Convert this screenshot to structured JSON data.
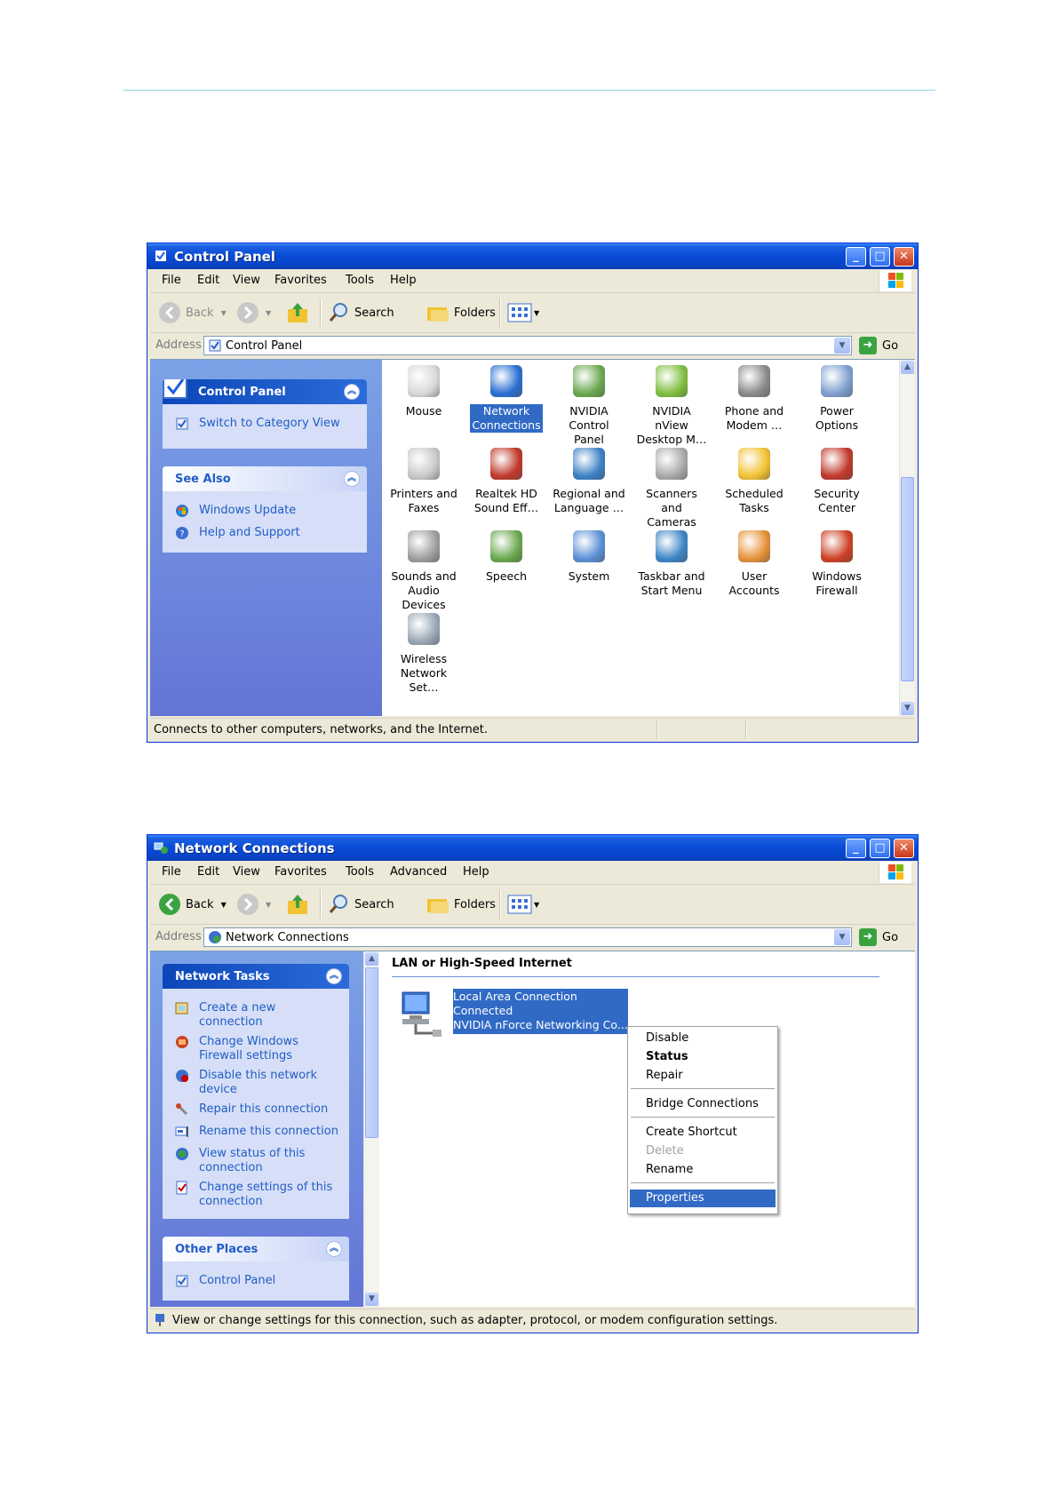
{
  "window1": {
    "title": "Control Panel",
    "menu": [
      "File",
      "Edit",
      "View",
      "Favorites",
      "Tools",
      "Help"
    ],
    "toolbar": {
      "back": "Back",
      "search": "Search",
      "folders": "Folders"
    },
    "address": {
      "label": "Address",
      "value": "Control Panel",
      "go": "Go"
    },
    "taskpane": {
      "control_panel": {
        "title": "Control Panel",
        "link": "Switch to Category View"
      },
      "see_also": {
        "title": "See Also",
        "links": [
          "Windows Update",
          "Help and Support"
        ]
      }
    },
    "items": [
      {
        "l1": "Mouse",
        "l2": "",
        "color": "#d8d8d8"
      },
      {
        "l1": "Network",
        "l2": "Connections",
        "color": "#2a6fd0"
      },
      {
        "l1": "NVIDIA",
        "l2": "Control Panel",
        "color": "#6aa84f"
      },
      {
        "l1": "NVIDIA nView",
        "l2": "Desktop M…",
        "color": "#7fbf3f"
      },
      {
        "l1": "Phone and",
        "l2": "Modem …",
        "color": "#8a8a8a"
      },
      {
        "l1": "Power Options",
        "l2": "",
        "color": "#7f9fcf"
      },
      {
        "l1": "Printers and",
        "l2": "Faxes",
        "color": "#c9c9c9"
      },
      {
        "l1": "Realtek HD",
        "l2": "Sound Eff…",
        "color": "#c0392b"
      },
      {
        "l1": "Regional and",
        "l2": "Language …",
        "color": "#3b82c4"
      },
      {
        "l1": "Scanners and",
        "l2": "Cameras",
        "color": "#a9a9a9"
      },
      {
        "l1": "Scheduled",
        "l2": "Tasks",
        "color": "#f1c232"
      },
      {
        "l1": "Security",
        "l2": "Center",
        "color": "#c0392b"
      },
      {
        "l1": "Sounds and",
        "l2": "Audio Devices",
        "color": "#9e9e9e"
      },
      {
        "l1": "Speech",
        "l2": "",
        "color": "#6aa84f"
      },
      {
        "l1": "System",
        "l2": "",
        "color": "#5b8fd6"
      },
      {
        "l1": "Taskbar and",
        "l2": "Start Menu",
        "color": "#3d85c6"
      },
      {
        "l1": "User Accounts",
        "l2": "",
        "color": "#e69138"
      },
      {
        "l1": "Windows",
        "l2": "Firewall",
        "color": "#cc4125"
      },
      {
        "l1": "Wireless",
        "l2": "Network Set…",
        "color": "#9aa7b5"
      }
    ],
    "status": "Connects to other computers, networks, and the Internet."
  },
  "window2": {
    "title": "Network Connections",
    "menu": [
      "File",
      "Edit",
      "View",
      "Favorites",
      "Tools",
      "Advanced",
      "Help"
    ],
    "toolbar": {
      "back": "Back",
      "search": "Search",
      "folders": "Folders"
    },
    "address": {
      "label": "Address",
      "value": "Network Connections",
      "go": "Go"
    },
    "taskpane": {
      "network_tasks": {
        "title": "Network Tasks",
        "links": [
          {
            "l1": "Create a new",
            "l2": "connection"
          },
          {
            "l1": "Change Windows",
            "l2": "Firewall settings"
          },
          {
            "l1": "Disable this network",
            "l2": "device"
          },
          {
            "l1": "Repair this connection",
            "l2": ""
          },
          {
            "l1": "Rename this connection",
            "l2": ""
          },
          {
            "l1": "View status of this",
            "l2": "connection"
          },
          {
            "l1": "Change settings of this",
            "l2": "connection"
          }
        ]
      },
      "other_places": {
        "title": "Other Places",
        "links": [
          "Control Panel"
        ]
      }
    },
    "group_header": "LAN or High-Speed Internet",
    "connection": {
      "name": "Local Area Connection",
      "state": "Connected",
      "device": "NVIDIA nForce Networking Co..."
    },
    "context_menu": [
      "Disable",
      "Status",
      "Repair",
      "Bridge Connections",
      "Create Shortcut",
      "Delete",
      "Rename",
      "Properties"
    ],
    "status": "View or change settings for this connection, such as adapter, protocol, or modem configuration settings."
  },
  "colors": {
    "title_blue": "#0a4bd6",
    "link_blue": "#215dc6",
    "selection": "#316ac5"
  }
}
